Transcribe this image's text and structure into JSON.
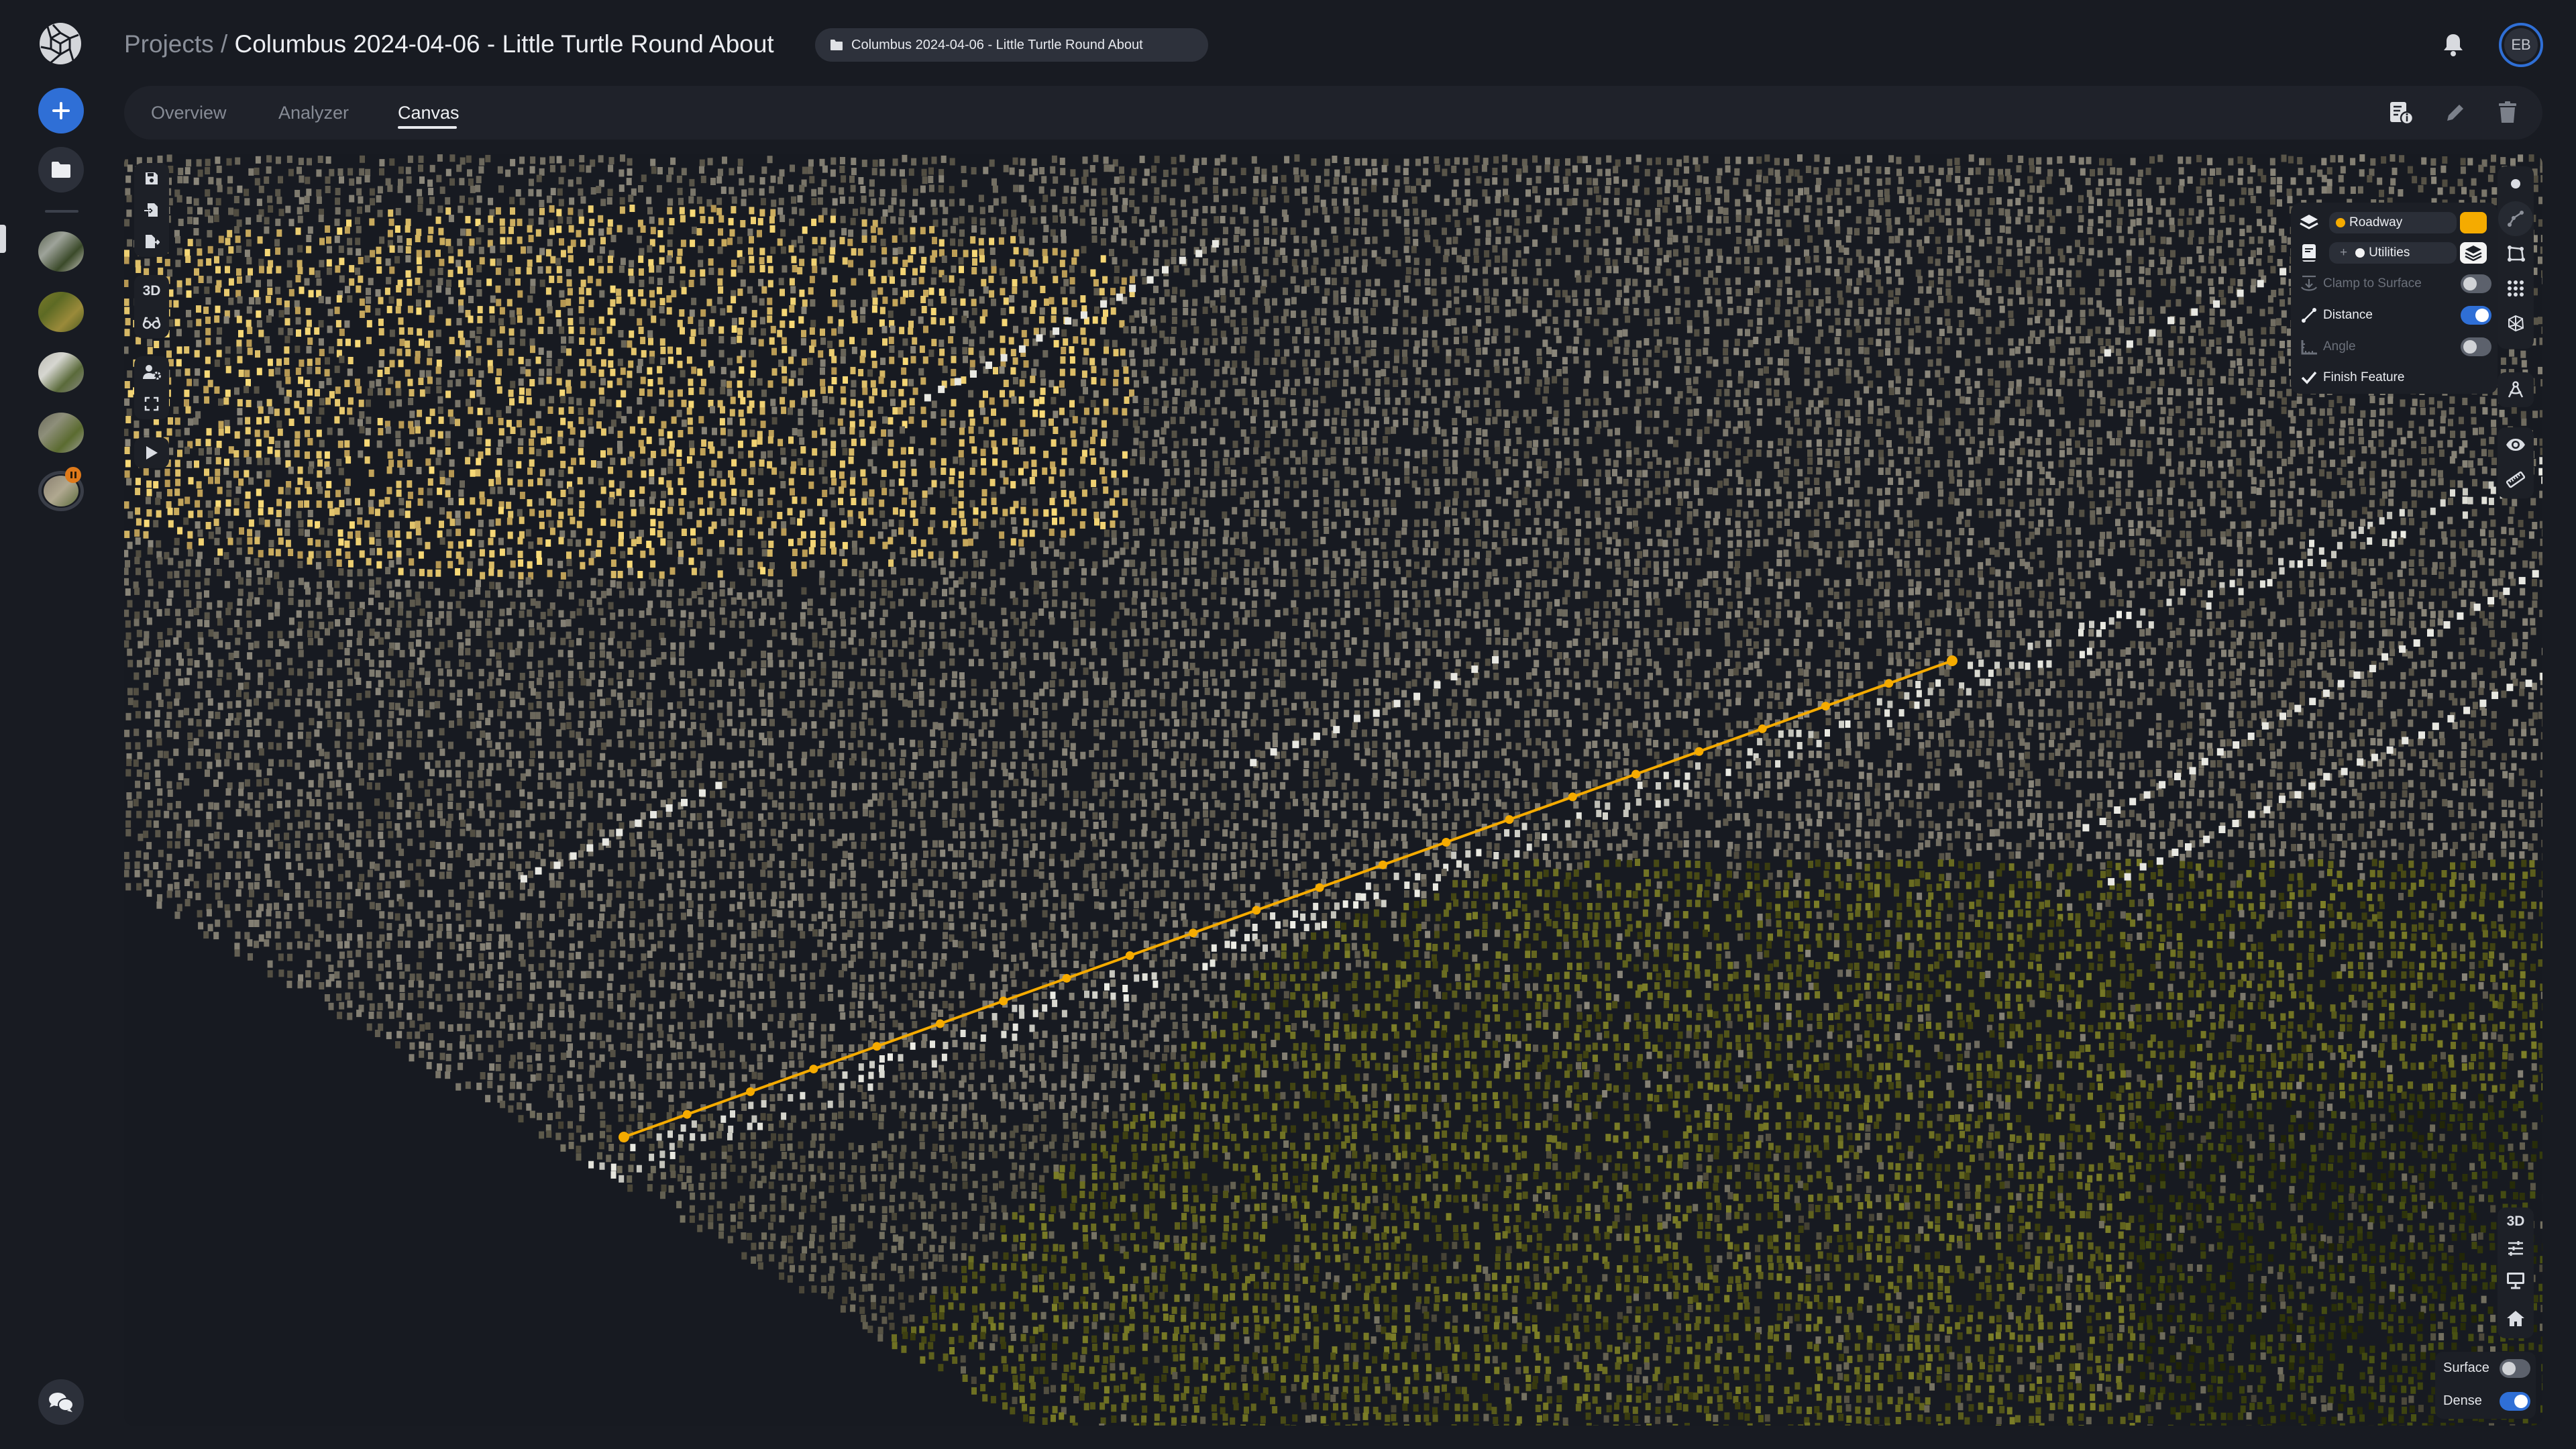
{
  "app": {
    "logo_icon": "aperture-cube-logo",
    "rail": {
      "new_button_icon": "plus-icon",
      "projects_button_icon": "folder-icon",
      "recent_projects": [
        {
          "name": "project-thumbnail-1",
          "palette": [
            "#5a6350",
            "#9ea39a",
            "#3b4a2a",
            "#c8c6c0"
          ],
          "active": true
        },
        {
          "name": "project-thumbnail-2",
          "palette": [
            "#7a7a2a",
            "#5d6a24",
            "#9a8a3a",
            "#4a5a20"
          ],
          "active": false
        },
        {
          "name": "project-thumbnail-3",
          "palette": [
            "#b8b8b0",
            "#d6d6d0",
            "#5a6a3a",
            "#8a8a84"
          ],
          "active": false
        },
        {
          "name": "project-thumbnail-4",
          "palette": [
            "#6a6a5a",
            "#8e8f7a",
            "#5b6b30",
            "#a0a098"
          ],
          "active": false
        },
        {
          "name": "project-thumbnail-5-processing",
          "palette": [
            "#8a8070",
            "#b0a890",
            "#5a6a3a"
          ],
          "active": false,
          "status": "paused",
          "progress": 0.3
        }
      ],
      "chat_icon": "chat-bubbles-icon"
    }
  },
  "header": {
    "breadcrumb_root": "Projects",
    "breadcrumb_sep": "/",
    "title": "Columbus 2024-04-06 - Little Turtle Round About",
    "chip_label": "Columbus 2024-04-06 - Little Turtle Round About",
    "chip_icon": "folder-icon",
    "notifications_icon": "bell-icon",
    "avatar_initials": "EB"
  },
  "tabs": [
    {
      "label": "Overview",
      "active": false
    },
    {
      "label": "Analyzer",
      "active": false
    },
    {
      "label": "Canvas",
      "active": true
    }
  ],
  "tab_actions": [
    {
      "name": "project-info-button",
      "icon": "document-info-icon"
    },
    {
      "name": "edit-button",
      "icon": "pencil-icon"
    },
    {
      "name": "delete-button",
      "icon": "trash-icon"
    }
  ],
  "canvas": {
    "left_tools": {
      "group1": [
        "save-icon",
        "import-file-icon",
        "export-file-icon"
      ],
      "group2": [
        {
          "icon": "3d-text",
          "label": "3D"
        },
        {
          "icon": "glasses-icon"
        }
      ],
      "group3": [
        "user-settings-icon",
        "fullscreen-icon"
      ],
      "group4": [
        "play-icon"
      ]
    },
    "right_tools": {
      "group1": [
        "point-icon",
        "polyline-icon",
        "polygon-icon",
        "grid-points-icon",
        "mesh-icon"
      ],
      "group2": [
        "compass-icon"
      ],
      "group3": [
        "eye-icon",
        "ruler-icon"
      ]
    },
    "layer_panel": {
      "layer_select": {
        "label": "Roadway",
        "dot_color": "#f5ab00"
      },
      "layer_color": "#f5ab00",
      "sublayer_select": {
        "prefix": "+",
        "label": "Utilities"
      },
      "options": [
        {
          "label": "Clamp to Surface",
          "icon": "clamp-down-icon",
          "enabled": false,
          "on": false
        },
        {
          "label": "Distance",
          "icon": "line-segment-icon",
          "enabled": true,
          "on": true
        },
        {
          "label": "Angle",
          "icon": "angle-ruler-icon",
          "enabled": false,
          "on": false
        }
      ],
      "finish_label": "Finish Feature"
    },
    "view_tools": [
      {
        "label": "3D"
      },
      {
        "icon": "sliders-icon"
      },
      {
        "icon": "monitor-icon"
      },
      {
        "icon": "home-icon"
      }
    ],
    "surface_label": "Surface",
    "surface_on": false,
    "dense_label": "Dense",
    "dense_on": true,
    "measurement": {
      "color": "#f5ab00",
      "vertex_count": 22
    }
  }
}
